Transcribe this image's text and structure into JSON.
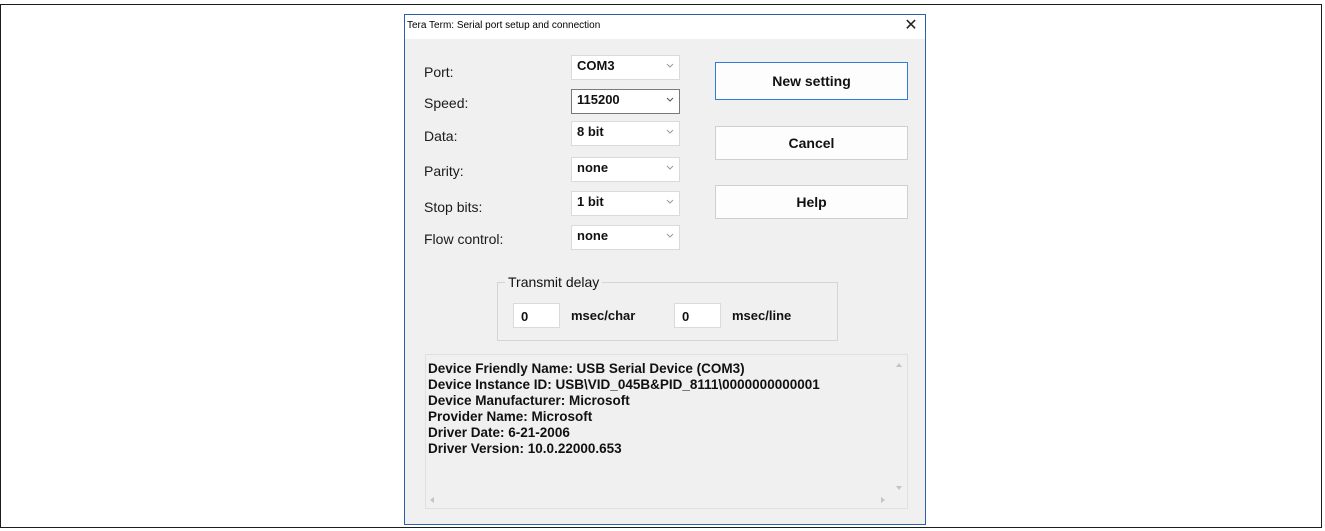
{
  "window": {
    "title": "Tera Term: Serial port setup and connection",
    "close_glyph": "✕"
  },
  "settings": [
    {
      "label": "Port:",
      "value": "COM3"
    },
    {
      "label": "Speed:",
      "value": "115200"
    },
    {
      "label": "Data:",
      "value": "8 bit"
    },
    {
      "label": "Parity:",
      "value": "none"
    },
    {
      "label": "Stop bits:",
      "value": "1 bit"
    },
    {
      "label": "Flow control:",
      "value": "none"
    }
  ],
  "buttons": {
    "new_setting": "New setting",
    "cancel": "Cancel",
    "help": "Help"
  },
  "transmit_delay": {
    "title": "Transmit delay",
    "char_value": "0",
    "char_unit": "msec/char",
    "line_value": "0",
    "line_unit": "msec/line"
  },
  "device_info": [
    "Device Friendly Name: USB Serial Device (COM3)",
    "Device Instance ID: USB\\VID_045B&PID_8111\\0000000000001",
    "Device Manufacturer: Microsoft",
    "Provider Name: Microsoft",
    "Driver Date: 6-21-2006",
    "Driver Version: 10.0.22000.653"
  ],
  "icons": {
    "dropdown": "chevron-down-icon",
    "close": "close-icon",
    "scroll_up": "triangle-up-icon",
    "scroll_down": "triangle-down-icon",
    "scroll_left": "triangle-left-icon",
    "scroll_right": "triangle-right-icon"
  },
  "colors": {
    "dialog_background": "#f0f0f0",
    "default_button_border": "#2f7bd6",
    "dialog_border": "#2b5fa6"
  }
}
